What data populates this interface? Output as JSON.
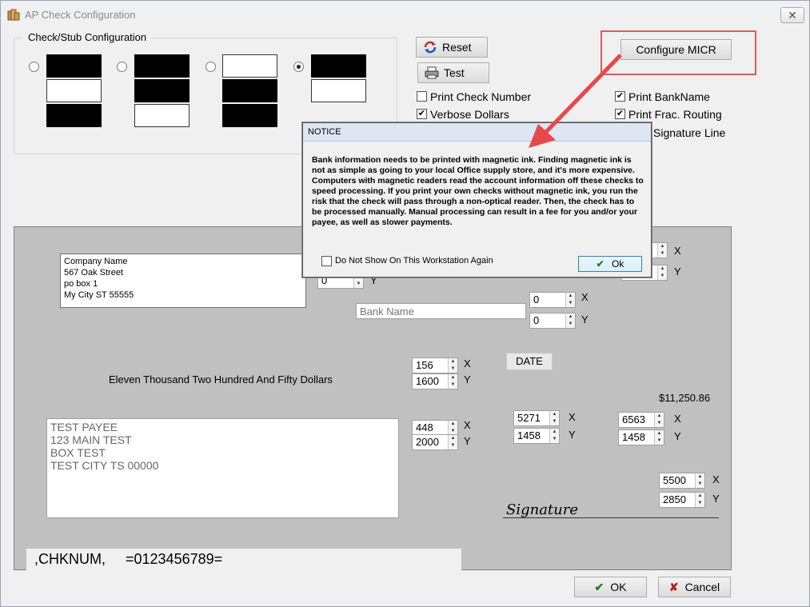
{
  "window": {
    "title": "AP Check Configuration",
    "close_glyph": "✕"
  },
  "group": {
    "label": "Check/Stub Configuration",
    "selected_option": 4
  },
  "buttons": {
    "reset": "Reset",
    "test": "Test",
    "configure_micr": "Configure MICR",
    "ok": "OK",
    "cancel": "Cancel"
  },
  "checkboxes": {
    "print_check_number": {
      "label": "Print Check Number",
      "checked": false
    },
    "verbose_dollars": {
      "label": "Verbose Dollars",
      "checked": true
    },
    "print_bankname": {
      "label": "Print BankName",
      "checked": true
    },
    "print_frac_routing": {
      "label": "Print Frac. Routing",
      "checked": true
    },
    "signature_line": {
      "label": "Signature Line"
    }
  },
  "check": {
    "company_lines": [
      "Company Name",
      "567 Oak Street",
      "po box 1",
      "My City ST 55555"
    ],
    "bank_name_placeholder": "Bank Name",
    "date_label": "DATE",
    "amount_words": "Eleven Thousand Two Hundred And Fifty Dollars",
    "amount_numeric": "$11,250.86",
    "payee_lines": [
      "TEST PAYEE",
      "123 MAIN TEST",
      "BOX TEST",
      "TEST CITY TS 00000"
    ],
    "micr_line": ",CHKNUM,     =0123456789=",
    "signature_text": "Signature",
    "axis_x": "X",
    "axis_y": "Y",
    "spins": {
      "company_y": "0",
      "bank_x": "0",
      "bank_y": "0",
      "words_x": "156",
      "words_y": "1600",
      "payee_x": "448",
      "payee_y": "2000",
      "date_x": "5271",
      "date_y": "1458",
      "amount_x": "6563",
      "amount_y": "1458",
      "sig_x": "5500",
      "sig_y": "2850"
    }
  },
  "notice": {
    "title": "NOTICE",
    "message": "Bank information needs to be printed with magnetic ink. Finding magnetic ink is not as simple as going to your local Office supply store, and it's more expensive. Computers with magnetic readers read the account information off these checks to speed processing. If you print your own checks without magnetic ink, you run the risk that the check will pass through a non-optical reader. Then, the check has to be processed manually. Manual processing can result in a fee for you and/or your payee, as well as slower payments.",
    "dont_show_label": "Do Not Show On This Workstation Again",
    "ok_label": "Ok"
  },
  "colors": {
    "highlight": "#e05a5a",
    "arrow": "#e8484a",
    "check_bg": "#c0c0c0"
  }
}
